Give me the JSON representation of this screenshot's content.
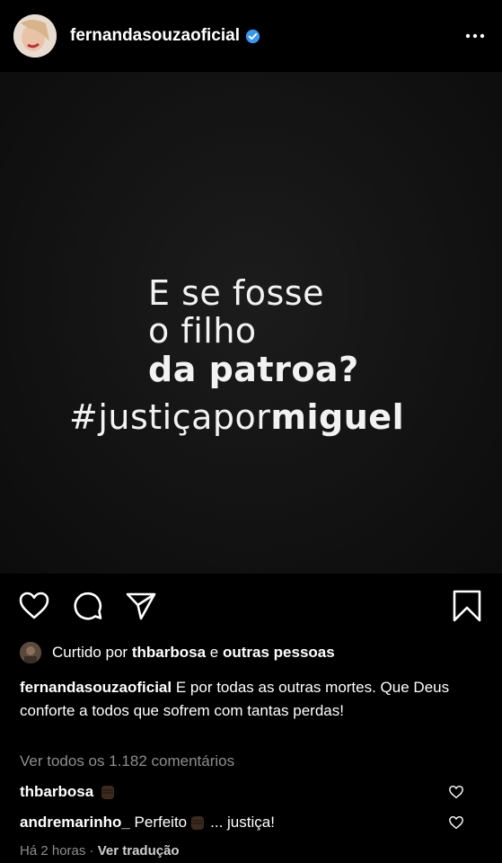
{
  "header": {
    "username": "fernandasouzaoficial",
    "verified": true,
    "more_icon": "more-horizontal-icon"
  },
  "post": {
    "line1": "E se fosse",
    "line2": "o filho",
    "line3": "da patroa?",
    "line4_a": "#justiçapor",
    "line4_b": "miguel"
  },
  "actions": {
    "like_icon": "heart-outline-icon",
    "comment_icon": "comment-icon",
    "share_icon": "send-icon",
    "save_icon": "bookmark-icon"
  },
  "likes": {
    "prefix": "Curtido por",
    "user": "thbarbosa",
    "joiner": "e",
    "others": "outras pessoas"
  },
  "caption": {
    "user": "fernandasouzaoficial",
    "text": "E por todas as outras mortes. Que Deus conforte a todos que sofrem com tantas perdas!"
  },
  "view_all": "Ver todos os 1.182 comentários",
  "comments": [
    {
      "user": "thbarbosa",
      "text": "",
      "emoji": "raised-fist"
    },
    {
      "user": "andremarinho_",
      "text": "Perfeito",
      "emoji": "raised-fist",
      "suffix": "... justiça!"
    }
  ],
  "footer": {
    "time": "Há 2 horas",
    "separator": "·",
    "translate": "Ver tradução"
  },
  "colors": {
    "background": "#000000",
    "verified_blue": "#3897f0",
    "muted_text": "#8e8e8e"
  }
}
